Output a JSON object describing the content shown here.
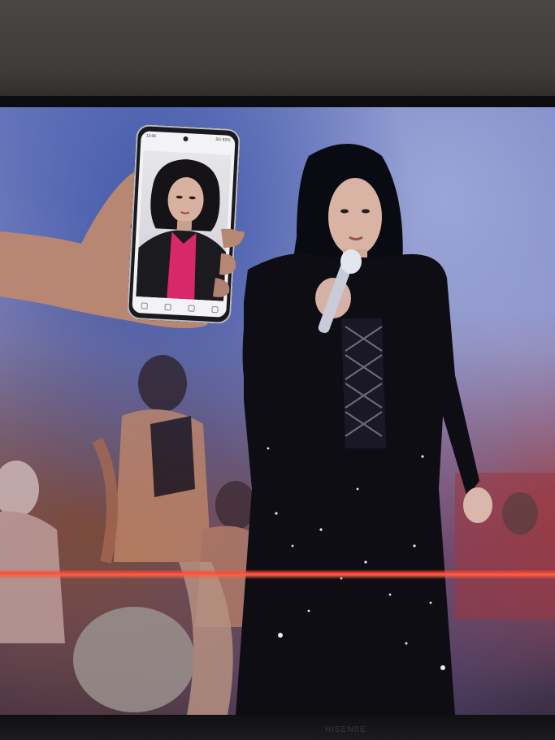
{
  "scene": {
    "description_tags": [
      "tv-screen",
      "performer",
      "smartphone",
      "hand"
    ],
    "colors": {
      "stage_blue": "#6f7cc0",
      "red_line": "#ff4a38",
      "shirt_pink": "#d8286a",
      "outfit_black": "#0e0d14"
    }
  },
  "phone": {
    "status_left": "12:00",
    "status_right": "5G 92%"
  },
  "tv": {
    "brand_mark": "HISENSE"
  }
}
